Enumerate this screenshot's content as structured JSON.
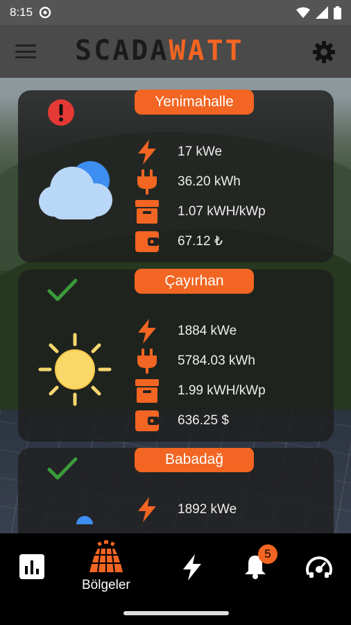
{
  "status_bar": {
    "time": "8:15"
  },
  "app": {
    "logo_left": "SCADA",
    "logo_right": "WATT"
  },
  "colors": {
    "accent": "#f26522",
    "ok": "#3a9a3a",
    "alert": "#e53935"
  },
  "plants": [
    {
      "name": "Yenimahalle",
      "status": "alert",
      "weather": "cloud-icon",
      "power": "17 kWe",
      "energy": "36.20 kWh",
      "yield": "1.07 kWH/kWp",
      "revenue": "67.12 ₺"
    },
    {
      "name": "Çayırhan",
      "status": "ok",
      "weather": "sun-icon",
      "power": "1884 kWe",
      "energy": "5784.03 kWh",
      "yield": "1.99 kWH/kWp",
      "revenue": "636.25 $"
    },
    {
      "name": "Babadağ",
      "status": "ok",
      "weather": "cloud-icon",
      "power": "1892 kWe"
    }
  ],
  "bottom_nav": {
    "items": [
      {
        "icon": "chart-icon",
        "label": ""
      },
      {
        "icon": "solar-panel-icon",
        "label": "Bölgeler"
      },
      {
        "icon": "lightning-icon",
        "label": ""
      },
      {
        "icon": "bell-icon",
        "label": ""
      },
      {
        "icon": "gauge-icon",
        "label": ""
      }
    ],
    "notification_count": "5"
  }
}
